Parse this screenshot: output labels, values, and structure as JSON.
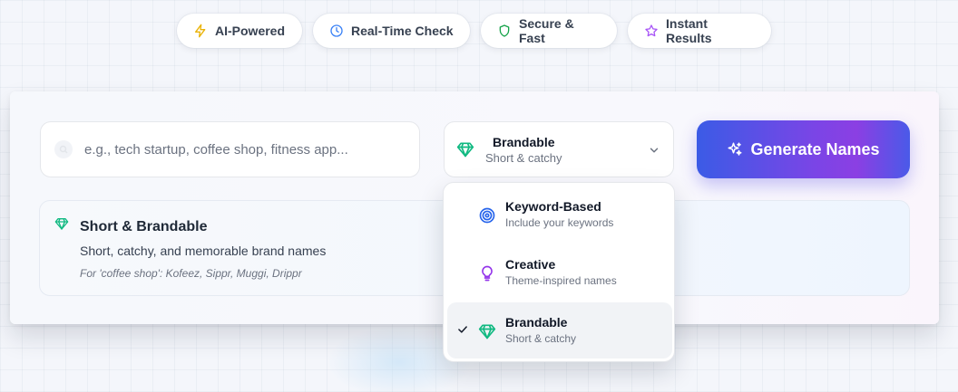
{
  "features": [
    {
      "label": "AI-Powered",
      "icon": "lightning-icon",
      "color": "#eab308"
    },
    {
      "label": "Real-Time Check",
      "icon": "clock-icon",
      "color": "#3b82f6"
    },
    {
      "label": "Secure & Fast",
      "icon": "shield-icon",
      "color": "#16a34a"
    },
    {
      "label": "Instant Results",
      "icon": "star-icon",
      "color": "#a855f7"
    }
  ],
  "search": {
    "placeholder": "e.g., tech startup, coffee shop, fitness app...",
    "value": ""
  },
  "style_select": {
    "selected_label": "Brandable",
    "selected_desc": "Short & catchy",
    "icon": "gem-icon"
  },
  "generate_button": {
    "label": "Generate Names",
    "icon": "sparkles-icon"
  },
  "info": {
    "title": "Short & Brandable",
    "description": "Short, catchy, and memorable brand names",
    "example": "For 'coffee shop': Kofeez, Sippr, Muggi, Drippr"
  },
  "dropdown": {
    "options": [
      {
        "label": "Keyword-Based",
        "desc": "Include your keywords",
        "icon": "target-icon",
        "selected": false
      },
      {
        "label": "Creative",
        "desc": "Theme-inspired names",
        "icon": "lightbulb-icon",
        "selected": false
      },
      {
        "label": "Brandable",
        "desc": "Short & catchy",
        "icon": "gem-icon",
        "selected": true
      }
    ]
  },
  "colors": {
    "gem": "#10b981",
    "target": "#2563eb",
    "bulb": "#9333ea",
    "accent_start": "#3b5be6",
    "accent_mid": "#8b3fe3"
  }
}
